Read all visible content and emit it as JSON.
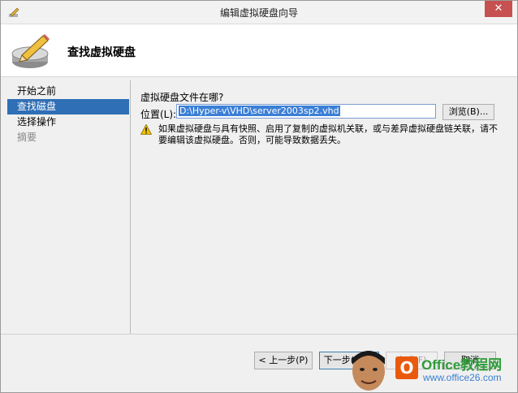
{
  "window": {
    "title": "编辑虚拟硬盘向导",
    "close_glyph": "✕"
  },
  "header": {
    "title": "查找虚拟硬盘",
    "icon": "disk-pencil-icon"
  },
  "nav": {
    "items": [
      {
        "label": "开始之前",
        "state": "normal"
      },
      {
        "label": "查找磁盘",
        "state": "active"
      },
      {
        "label": "选择操作",
        "state": "normal"
      },
      {
        "label": "摘要",
        "state": "disabled"
      }
    ]
  },
  "main": {
    "question": "虚拟硬盘文件在哪?",
    "location_label": "位置(L):",
    "location_value": "D:\\Hyper-v\\VHD\\server2003sp2.vhd",
    "browse_label": "浏览(B)...",
    "warning_icon": "warning-icon",
    "warning_text": "如果虚拟硬盘与具有快照、启用了复制的虚拟机关联，或与差异虚拟硬盘链关联，请不要编辑该虚拟硬盘。否则，可能导致数据丢失。"
  },
  "footer": {
    "prev_label": "< 上一步(P)",
    "next_label": "下一步(N) >",
    "finish_label": "完成(F)",
    "cancel_label": "取消"
  },
  "watermark": {
    "logo_glyph": "O",
    "brand": "Office教程网",
    "url": "www.office26.com"
  },
  "colors": {
    "nav_active": "#2f6fb5",
    "close_button": "#c75050",
    "warning": "#f2c200"
  }
}
